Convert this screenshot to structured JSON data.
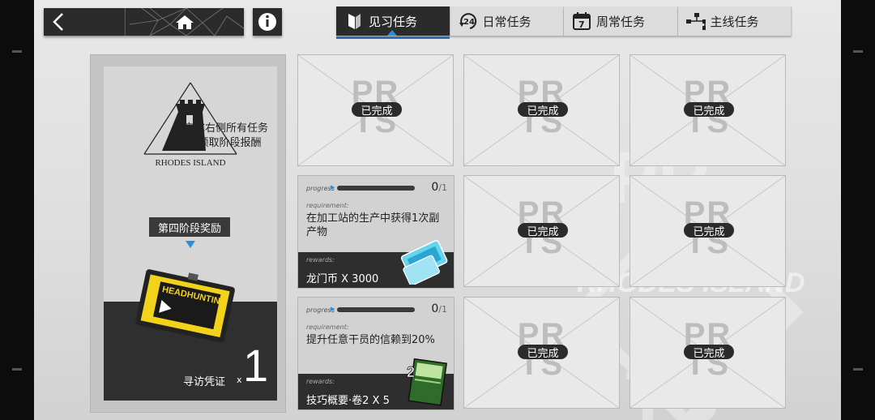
{
  "tabs": [
    {
      "label": "见习任务",
      "icon": "trainee-flag-icon",
      "active": true
    },
    {
      "label": "日常任务",
      "icon": "daily-24h-icon",
      "active": false
    },
    {
      "label": "周常任务",
      "icon": "weekly-calendar-icon",
      "active": false
    },
    {
      "label": "主线任务",
      "icon": "mainline-tree-icon",
      "active": false
    }
  ],
  "tab_calendar_day": "7",
  "tab_24": "24",
  "left_panel": {
    "logo_text": "RHODES ISLAND",
    "description_line1": "·完成右侧所有任务",
    "description_line2": "以领取阶段报酬",
    "stage_button": "第四阶段奖励",
    "reward_card_text": "HEADHUNTING",
    "reward_name": "寻访凭证",
    "reward_x": "x",
    "reward_count": "1"
  },
  "completed_label": "已完成",
  "watermark_text": "PRTS",
  "bg_logo": "RHODES ISLAND",
  "tasks": [
    {
      "progress_label": "progress",
      "progress_value": "0",
      "progress_total": "1",
      "progress_fraction": 0,
      "requirement_label": "requirement:",
      "requirement": "在加工站的生产中获得1次副产物",
      "rewards_label": "rewards:",
      "reward": "龙门币 X 3000",
      "reward_icon": "lmd-currency-icon"
    },
    {
      "progress_label": "progress",
      "progress_value": "0",
      "progress_total": "1",
      "progress_fraction": 0,
      "requirement_label": "requirement:",
      "requirement": "提升任意干员的信赖到20%",
      "rewards_label": "rewards:",
      "reward": "技巧概要·卷2 X 5",
      "reward_icon": "skill-summary-book-icon",
      "reward_badge": "2"
    }
  ],
  "colors": {
    "accent_blue": "#2a8fd8",
    "dark": "#2b2b2b"
  }
}
